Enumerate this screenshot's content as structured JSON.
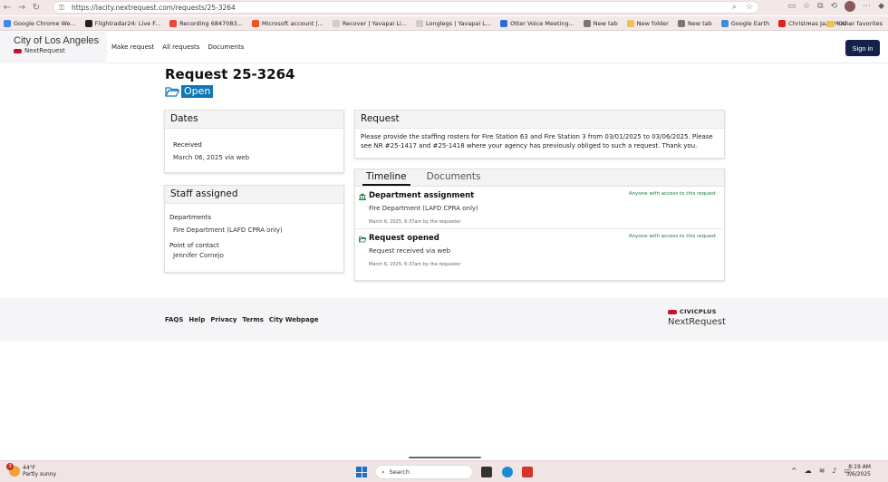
{
  "browser": {
    "url": "https://lacity.nextrequest.com/requests/25-3264",
    "bookmarks": [
      {
        "label": "Google Chrome We...",
        "color": "#4285f4"
      },
      {
        "label": "Flightradar24: Live F...",
        "color": "#222222"
      },
      {
        "label": "Recording 6847083...",
        "color": "#e8463a"
      },
      {
        "label": "Microsoft account |...",
        "color": "#f25022"
      },
      {
        "label": "Recover | Yavapai Li...",
        "color": "#cccccc"
      },
      {
        "label": "Longlegs | Yavapai L...",
        "color": "#cccccc"
      },
      {
        "label": "Otter Voice Meeting...",
        "color": "#2b6cd4"
      },
      {
        "label": "New tab",
        "color": "#777777"
      },
      {
        "label": "New folder",
        "color": "#e8c25a"
      },
      {
        "label": "New tab",
        "color": "#777777"
      },
      {
        "label": "Google Earth",
        "color": "#3a8fd9"
      },
      {
        "label": "Christmas Jazz Musi...",
        "color": "#e02020"
      }
    ],
    "other_favorites": "Other favorites"
  },
  "header": {
    "city": "City of Los Angeles",
    "product": "NextRequest",
    "nav": [
      "Make request",
      "All requests",
      "Documents"
    ],
    "sign_in": "Sign in"
  },
  "request": {
    "title": "Request 25-3264",
    "status": "Open",
    "dates_heading": "Dates",
    "received_label": "Received",
    "received_value": "March 06, 2025 via web",
    "staff_heading": "Staff assigned",
    "departments_label": "Departments",
    "departments_value": "Fire Department (LAFD CPRA only)",
    "poc_label": "Point of contact",
    "poc_value": "Jennifer Cornejo",
    "request_heading": "Request",
    "request_text": "Please provide the staffing rosters for Fire Station 63 and Fire Station 3 from 03/01/2025 to 03/06/2025. Please see NR #25-1417 and #25-1418 where your agency has previously obliged to such a request. Thank you."
  },
  "timeline": {
    "tabs": [
      "Timeline",
      "Documents"
    ],
    "items": [
      {
        "title": "Department assignment",
        "visibility": "Anyone with access to this request",
        "desc": "Fire Department (LAFD CPRA only)",
        "meta": "March 6, 2025, 6:37am by the requester",
        "icon": "building-icon"
      },
      {
        "title": "Request opened",
        "visibility": "Anyone with access to this request",
        "desc": "Request received via web",
        "meta": "March 6, 2025, 6:37am by the requester",
        "icon": "folder-open-icon"
      }
    ]
  },
  "footer": {
    "links": [
      "FAQS",
      "Help",
      "Privacy",
      "Terms",
      "City Webpage"
    ],
    "brand_top": "CIVICPLUS",
    "brand_bottom": "NextRequest"
  },
  "taskbar": {
    "temp": "44°F",
    "weather": "Partly sunny",
    "weather_badge": "3",
    "search": "Search",
    "time": "8:19 AM",
    "date": "3/6/2025"
  },
  "colors": {
    "accent": "#1077b8",
    "signin": "#12224a",
    "visibility": "#1a7a3c",
    "brand_red": "#c8102e"
  }
}
